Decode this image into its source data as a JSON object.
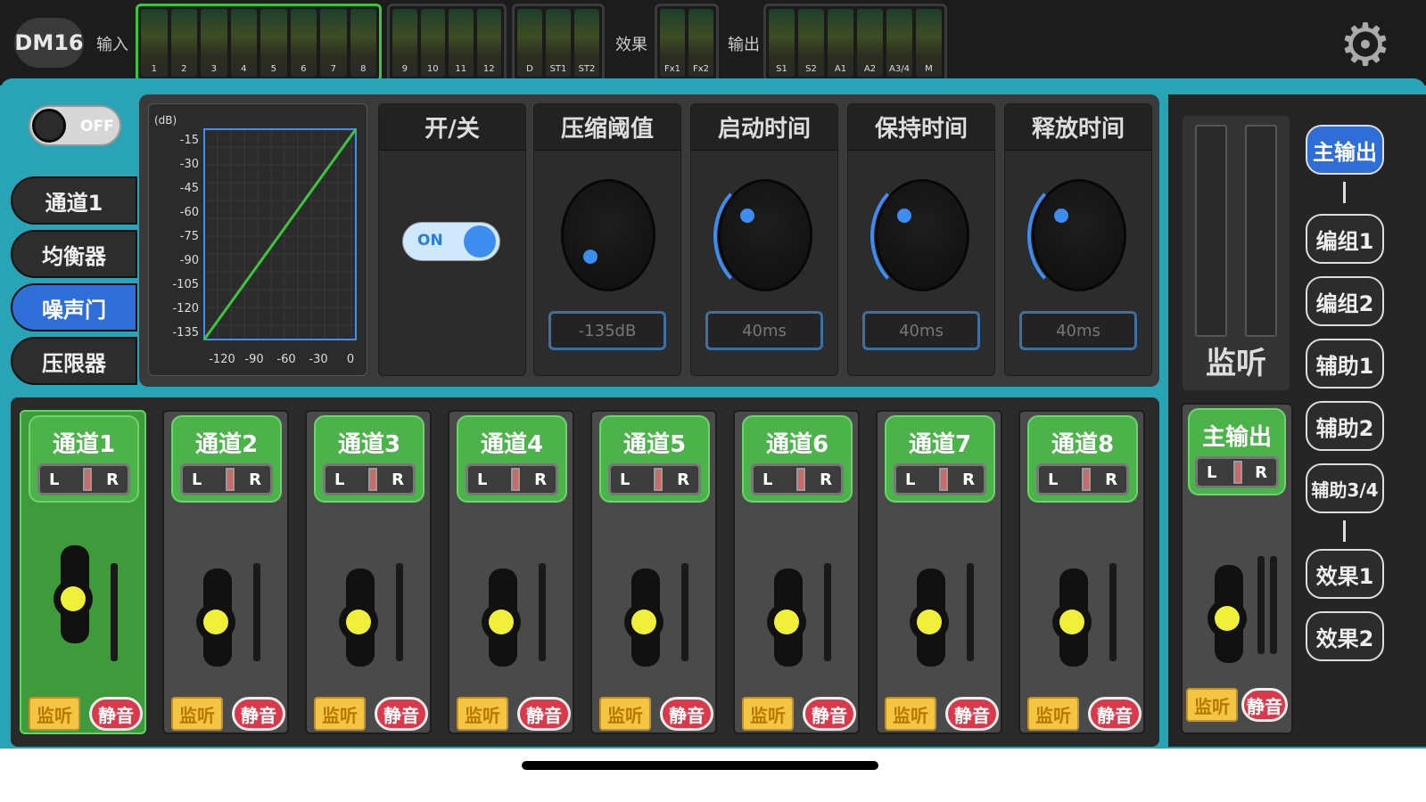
{
  "header": {
    "logo": "DM16",
    "input_label": "输入",
    "effect_label": "效果",
    "output_label": "输出",
    "meter_groups": [
      {
        "selected": true,
        "labels": [
          "1",
          "2",
          "3",
          "4",
          "5",
          "6",
          "7",
          "8"
        ]
      },
      {
        "selected": false,
        "labels": [
          "9",
          "10",
          "11",
          "12"
        ]
      },
      {
        "selected": false,
        "labels": [
          "D",
          "ST1",
          "ST2"
        ]
      },
      {
        "selected": false,
        "labels": [
          "Fx1",
          "Fx2"
        ]
      },
      {
        "selected": false,
        "labels": [
          "S1",
          "S2",
          "A1",
          "A2",
          "A3/4",
          "M"
        ]
      }
    ],
    "settings_icon": "gear-icon"
  },
  "sidebar": {
    "toggle_label": "OFF",
    "items": [
      {
        "label": "通道1",
        "active": false
      },
      {
        "label": "均衡器",
        "active": false
      },
      {
        "label": "噪声门",
        "active": true
      },
      {
        "label": "压限器",
        "active": false
      }
    ]
  },
  "gate": {
    "graph": {
      "unit_label": "(dB)",
      "y_ticks": [
        "-15",
        "-30",
        "-45",
        "-60",
        "-75",
        "-90",
        "-105",
        "-120",
        "-135"
      ],
      "x_ticks": [
        "-120",
        "-90",
        "-60",
        "-30",
        "0"
      ]
    },
    "switch": {
      "header": "开/关",
      "value": "ON"
    },
    "threshold": {
      "header": "压缩阈值",
      "value": "-135dB",
      "level": 0.0
    },
    "attack": {
      "header": "启动时间",
      "value": "40ms"
    },
    "hold": {
      "header": "保持时间",
      "value": "40ms"
    },
    "release": {
      "header": "释放时间",
      "value": "40ms"
    }
  },
  "channels": [
    {
      "name": "通道1",
      "active": true
    },
    {
      "name": "通道2",
      "active": false
    },
    {
      "name": "通道3",
      "active": false
    },
    {
      "name": "通道4",
      "active": false
    },
    {
      "name": "通道5",
      "active": false
    },
    {
      "name": "通道6",
      "active": false
    },
    {
      "name": "通道7",
      "active": false
    },
    {
      "name": "通道8",
      "active": false
    }
  ],
  "strip_labels": {
    "pan_left": "L",
    "pan_right": "R",
    "monitor": "监听",
    "mute": "静音"
  },
  "monitor": {
    "label": "监听"
  },
  "main_strip": {
    "name": "主输出"
  },
  "bus_buttons": [
    {
      "label": "主输出",
      "active": true
    },
    {
      "label": "编组1",
      "active": false
    },
    {
      "label": "编组2",
      "active": false
    },
    {
      "label": "辅助1",
      "active": false
    },
    {
      "label": "辅助2",
      "active": false
    },
    {
      "label": "辅助3/4",
      "active": false
    },
    {
      "label": "效果1",
      "active": false
    },
    {
      "label": "效果2",
      "active": false
    }
  ],
  "colors": {
    "accent_blue": "#2f6dd8",
    "channel_green": "#4cb24a",
    "teal_frame": "#28a4b6",
    "mute_red": "#d9394a",
    "monitor_yellow": "#f4c443"
  }
}
